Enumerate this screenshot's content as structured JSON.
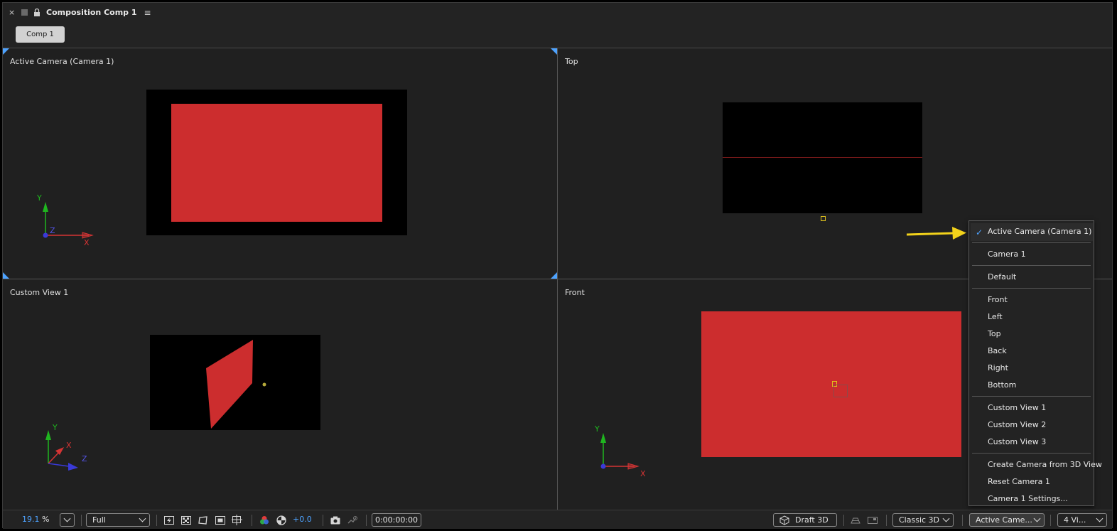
{
  "panel": {
    "close_glyph": "×",
    "title": "Composition Comp 1",
    "menu_glyph": "≡",
    "tab_label": "Comp 1"
  },
  "viewports": {
    "top_left": {
      "label": "Active Camera (Camera 1)"
    },
    "top_right": {
      "label": "Top"
    },
    "bottom_left": {
      "label": "Custom View 1"
    },
    "bottom_right": {
      "label": "Front"
    }
  },
  "axes": {
    "x": "X",
    "y": "Y",
    "z": "Z"
  },
  "toolbar": {
    "zoom_value": "19.1",
    "zoom_unit": "%",
    "resolution": "Full",
    "exposure": "+0.0",
    "timecode": "0:00:00:00",
    "renderer_label": "Draft 3D",
    "renderer_mode": "Classic 3D",
    "view_select": "Active Came...",
    "layout_select": "4 Vi..."
  },
  "dropdown": {
    "selected_check": "✓",
    "groups": [
      [
        "Active Camera (Camera 1)"
      ],
      [
        "Camera 1"
      ],
      [
        "Default"
      ],
      [
        "Front",
        "Left",
        "Top",
        "Back",
        "Right",
        "Bottom"
      ],
      [
        "Custom View 1",
        "Custom View 2",
        "Custom View 3"
      ],
      [
        "Create Camera from 3D View",
        "Reset Camera 1",
        "Camera 1 Settings..."
      ]
    ]
  },
  "colors": {
    "accent_blue": "#4ea3ff",
    "layer_red": "#cc2d2e",
    "annotation_arrow": "#f2d21b"
  }
}
